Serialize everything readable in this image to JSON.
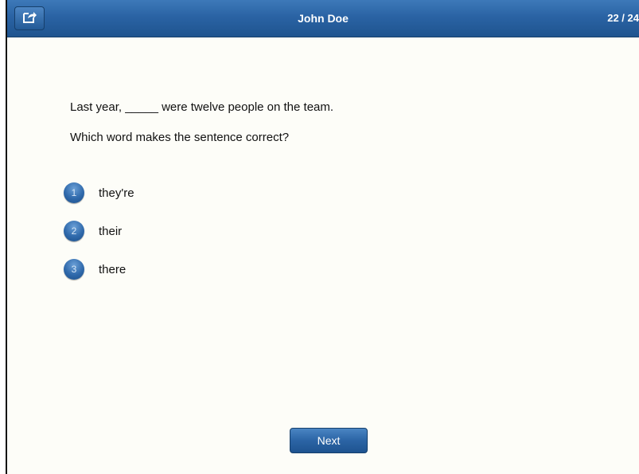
{
  "header": {
    "title": "John Doe",
    "progress": "22 / 24",
    "share_icon": "share-icon"
  },
  "question": {
    "sentence": "Last year, _____ were twelve people on the team.",
    "prompt": "Which word makes the sentence correct?"
  },
  "options": [
    {
      "number": "1",
      "label": "they're"
    },
    {
      "number": "2",
      "label": "their"
    },
    {
      "number": "3",
      "label": "there"
    }
  ],
  "footer": {
    "next_label": "Next"
  },
  "colors": {
    "accent": "#2a63a4",
    "background": "#fdfdf8"
  }
}
